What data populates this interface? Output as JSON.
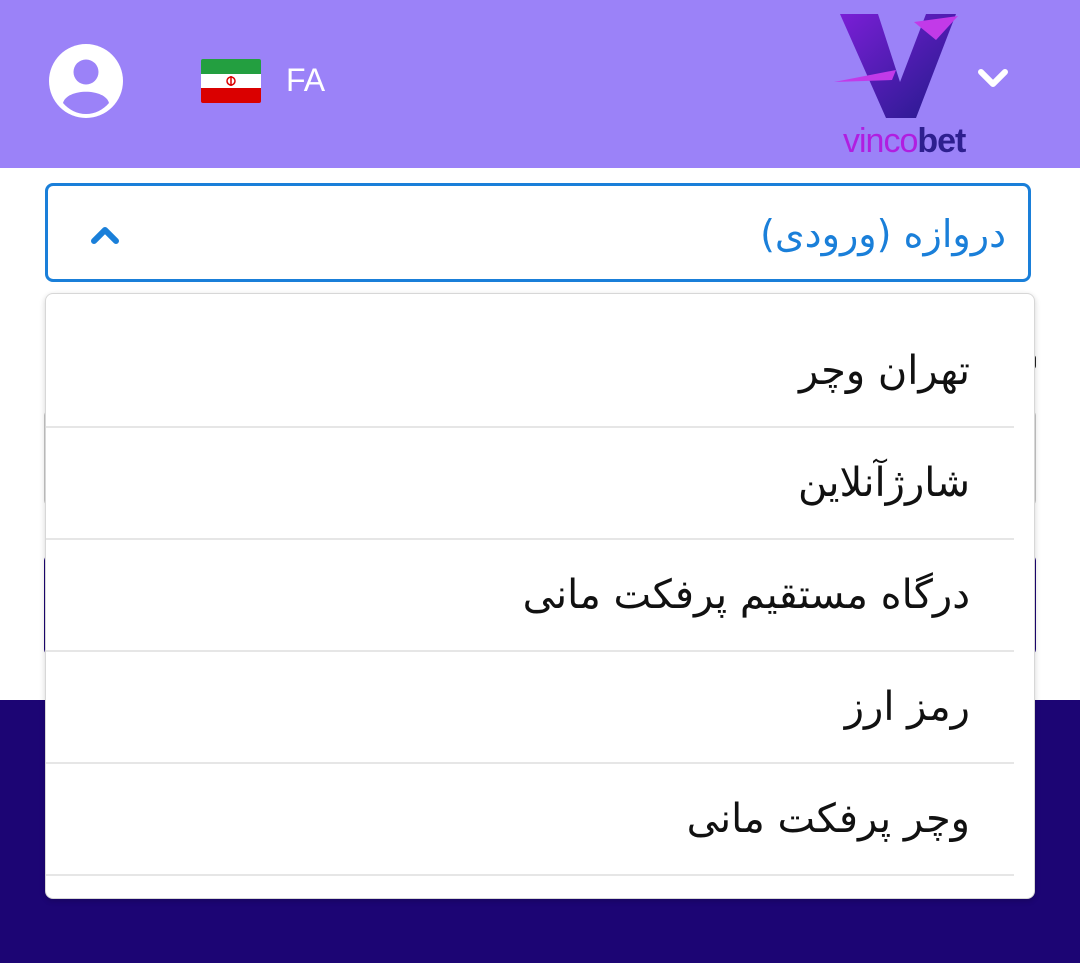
{
  "header": {
    "language_code": "FA",
    "brand": {
      "part1": "vinco",
      "part2": "bet"
    },
    "icons": {
      "account": "user-circle-icon",
      "flag": "iran-flag-icon",
      "menu": "chevron-down-icon"
    },
    "colors": {
      "background": "#9b82f8",
      "brand_purple": "#b01ee0",
      "brand_navy": "#2d1f8f"
    }
  },
  "gateway_select": {
    "selected_label": "دروازه (ورودی)",
    "icon": "chevron-up-icon",
    "accent": "#1a7fd9",
    "options": [
      {
        "label": "تهران وچر"
      },
      {
        "label": "شارژآنلاین"
      },
      {
        "label": "درگاه مستقیم پرفکت مانی"
      },
      {
        "label": "رمز ارز"
      },
      {
        "label": "وچر پرفکت مانی"
      }
    ]
  },
  "page": {
    "dark_color": "#1c0574"
  }
}
